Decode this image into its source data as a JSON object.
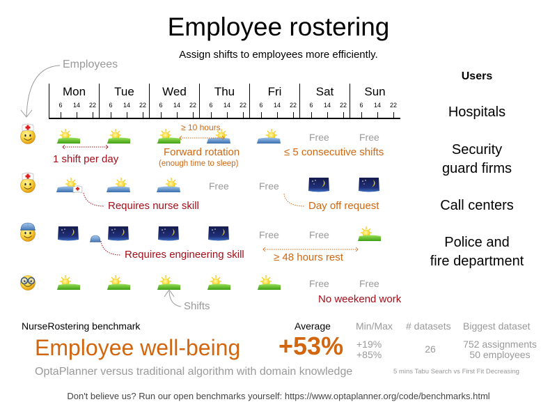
{
  "header": {
    "title": "Employee rostering",
    "subtitle": "Assign shifts to employees more efficiently."
  },
  "annotations": {
    "employees": "Employees",
    "shifts": "Shifts"
  },
  "timeline": {
    "days": [
      "Mon",
      "Tue",
      "Wed",
      "Thu",
      "Fri",
      "Sat",
      "Sun"
    ],
    "hour_ticks": [
      "6",
      "14",
      "22"
    ]
  },
  "users": {
    "heading": "Users",
    "items": [
      {
        "line1": "Hospitals",
        "line2": ""
      },
      {
        "line1": "Security",
        "line2": "guard firms"
      },
      {
        "line1": "Call centers",
        "line2": ""
      },
      {
        "line1": "Police and",
        "line2": "fire department"
      }
    ]
  },
  "employees": [
    {
      "type": "nurse",
      "icon": "nurse-avatar-icon"
    },
    {
      "type": "nurse",
      "icon": "nurse-avatar-icon"
    },
    {
      "type": "engineer",
      "icon": "engineer-avatar-icon"
    },
    {
      "type": "glasses",
      "icon": "glasses-avatar-icon"
    }
  ],
  "roster": [
    [
      "day",
      "day",
      "day",
      "late",
      "late",
      "free",
      "free"
    ],
    [
      "late",
      "late",
      "late",
      "free",
      "free",
      "night",
      "night"
    ],
    [
      "night",
      "night",
      "night",
      "night",
      "free",
      "free",
      "day"
    ],
    [
      "day",
      "day",
      "day",
      "day",
      "day",
      "free",
      "free"
    ]
  ],
  "free_label": "Free",
  "constraints": {
    "one_shift_per_day": "1 shift per day",
    "ten_hours": "≥ 10 hours",
    "forward_rotation": "Forward rotation",
    "enough_sleep": "(enough time to sleep)",
    "consecutive": "≤ 5 consecutive shifts",
    "nurse_skill": "Requires nurse skill",
    "day_off": "Day off request",
    "engineering_skill": "Requires engineering skill",
    "rest_48": "≥ 48 hours rest",
    "no_weekend": "No weekend work"
  },
  "colors": {
    "hard_constraint": "#a50d18",
    "soft_constraint": "#d2660f",
    "muted": "#999999"
  },
  "benchmark": {
    "name": "NurseRostering benchmark",
    "headline": "Employee well-being",
    "comparison": "OptaPlanner versus traditional algorithm with domain knowledge",
    "average_label": "Average",
    "average_value": "+53%",
    "minmax_label": "Min/Max",
    "min_value": "+19%",
    "max_value": "+85%",
    "datasets_label": "# datasets",
    "datasets_value": "26",
    "biggest_label": "Biggest dataset",
    "biggest_line1": "752 assignments",
    "biggest_line2": "50 employees",
    "note": "5 mins Tabu Search vs First Fit Decreasing"
  },
  "footer": "Don't believe us? Run our open benchmarks yourself: https://www.optaplanner.org/code/benchmarks.html"
}
